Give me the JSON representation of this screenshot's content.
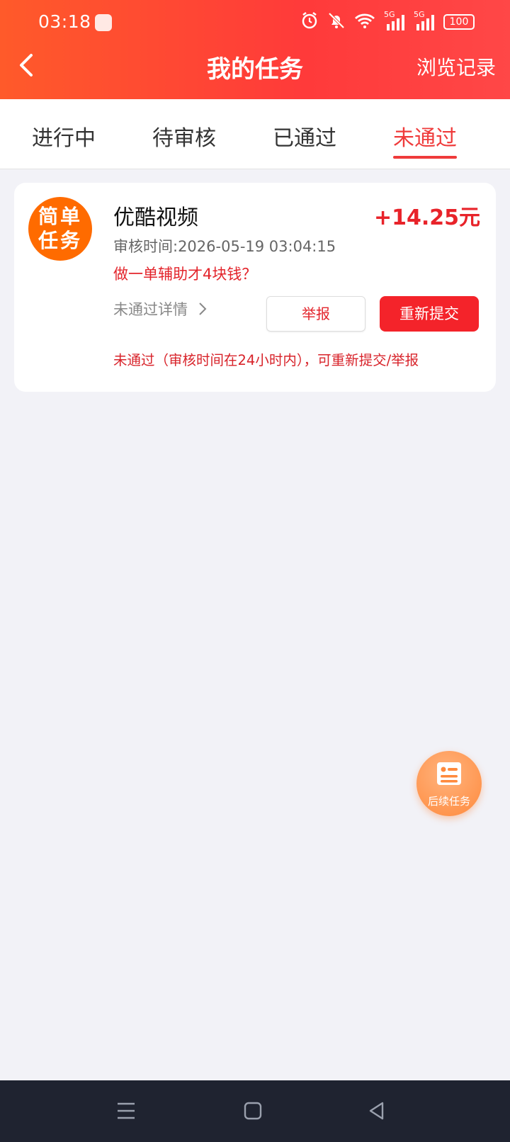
{
  "status_bar": {
    "time": "03:18",
    "net1": "5G",
    "net2": "5G",
    "battery": "100",
    "icons": [
      "alarm-icon",
      "mute-icon",
      "wifi-icon",
      "signal-icon",
      "signal-icon",
      "battery-icon"
    ]
  },
  "header": {
    "title": "我的任务",
    "right_link": "浏览记录"
  },
  "tabs": [
    "进行中",
    "待审核",
    "已通过",
    "未通过"
  ],
  "active_tab": 3,
  "task": {
    "badge_line1": "简单",
    "badge_line2": "任务",
    "app_name": "优酷视频",
    "reward": "+14.25元",
    "review_time": "审核时间:2026-05-19 03:04:15",
    "note": "做一单辅助才4块钱？",
    "detail_link": "未通过详情",
    "report_label": "举报",
    "resubmit_label": "重新提交",
    "status_message": "未通过（审核时间在24小时内），可重新提交/举报"
  },
  "fab": {
    "label": "后续任务"
  },
  "colors": {
    "header_start": "#ff5a2a",
    "header_end": "#ff4747",
    "accent_red": "#ef3b3b",
    "badge_orange": "#ff6b00",
    "nav_bar": "#1f2330"
  }
}
